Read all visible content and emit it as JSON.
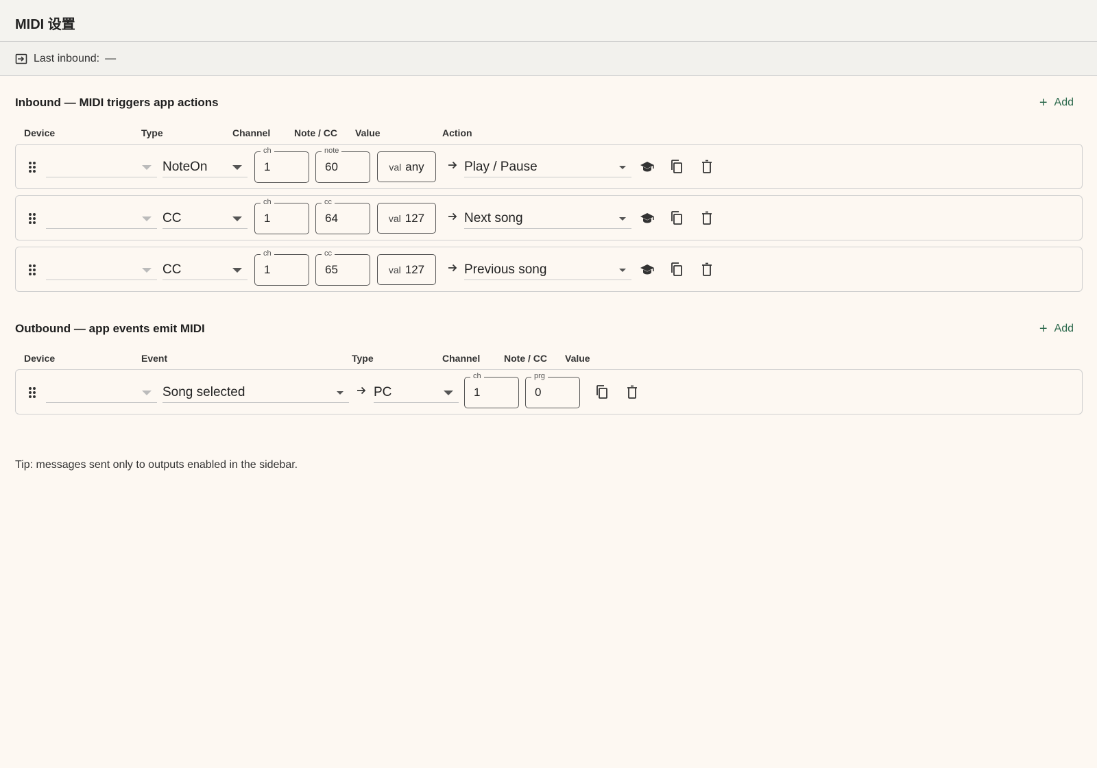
{
  "header": {
    "title": "MIDI 设置"
  },
  "status": {
    "label": "Last inbound:",
    "value": "—"
  },
  "inbound": {
    "title": "Inbound — MIDI triggers app actions",
    "add_label": "Add",
    "columns": [
      "Device",
      "Type",
      "Channel",
      "Note / CC",
      "Value",
      "Action"
    ],
    "rows": [
      {
        "device": "",
        "type": "NoteOn",
        "channel_legend": "ch",
        "channel": "1",
        "note_legend": "note",
        "note": "60",
        "value_label": "val",
        "value": "any",
        "action": "Play / Pause"
      },
      {
        "device": "",
        "type": "CC",
        "channel_legend": "ch",
        "channel": "1",
        "note_legend": "cc",
        "note": "64",
        "value_label": "val",
        "value": "127",
        "action": "Next song"
      },
      {
        "device": "",
        "type": "CC",
        "channel_legend": "ch",
        "channel": "1",
        "note_legend": "cc",
        "note": "65",
        "value_label": "val",
        "value": "127",
        "action": "Previous song"
      }
    ]
  },
  "outbound": {
    "title": "Outbound — app events emit MIDI",
    "add_label": "Add",
    "columns": [
      "Device",
      "Event",
      "Type",
      "Channel",
      "Note / CC",
      "Value"
    ],
    "rows": [
      {
        "device": "",
        "event": "Song selected",
        "type": "PC",
        "channel_legend": "ch",
        "channel": "1",
        "prg_legend": "prg",
        "prg": "0"
      }
    ]
  },
  "tip": "Tip: messages sent only to outputs enabled in the sidebar.",
  "icons": {
    "drag": "drag-handle-icon",
    "learn": "learn-icon",
    "duplicate": "duplicate-icon",
    "delete": "delete-icon",
    "arrow": "arrow-right-icon",
    "inbound": "inbound-icon"
  },
  "colors": {
    "accent": "#2f6b4f",
    "background": "#fdf8f2",
    "header": "#f4f3ef"
  }
}
